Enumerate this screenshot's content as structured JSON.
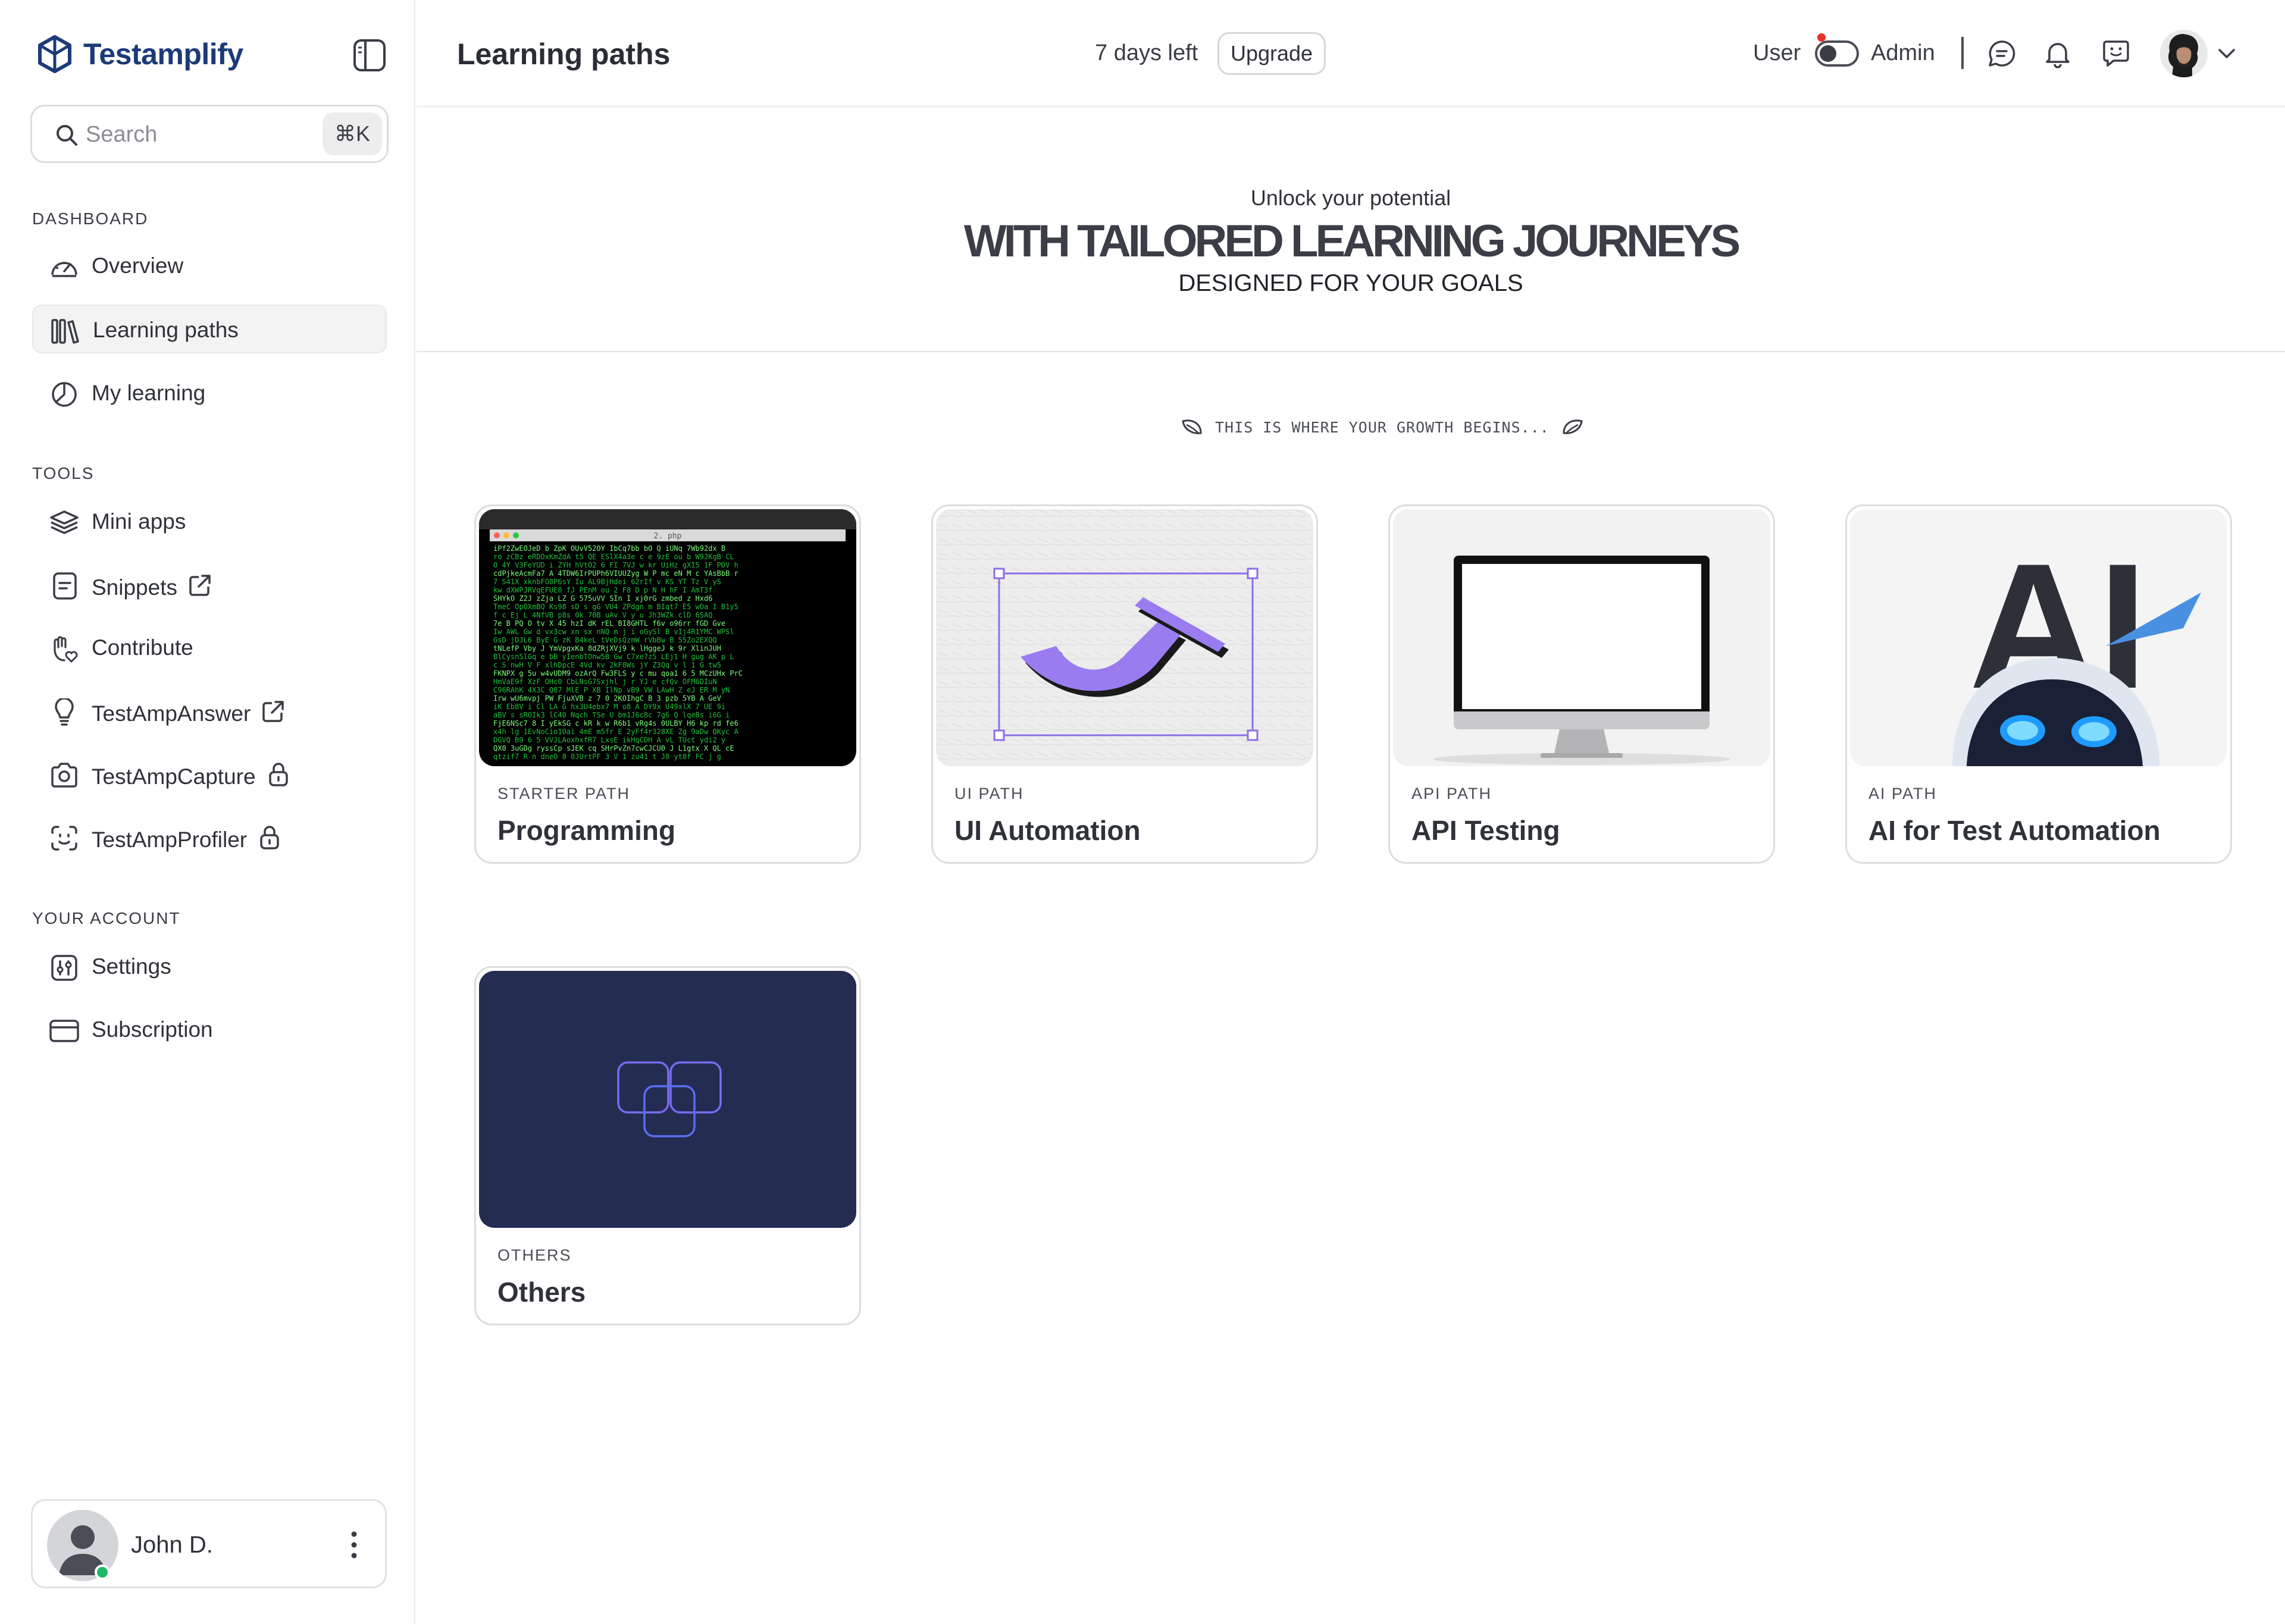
{
  "app": {
    "name": "Testamplify"
  },
  "search": {
    "placeholder": "Search",
    "shortcut": "⌘K"
  },
  "sidebar": {
    "sections": {
      "dashboard": "DASHBOARD",
      "tools": "TOOLS",
      "account": "YOUR ACCOUNT"
    },
    "items": [
      {
        "label": "Overview",
        "icon": "gauge-icon"
      },
      {
        "label": "Learning paths",
        "icon": "library-icon",
        "active": true
      },
      {
        "label": "My learning",
        "icon": "pie-chart-icon"
      },
      {
        "label": "Mini apps",
        "icon": "layers-icon"
      },
      {
        "label": "Snippets",
        "icon": "file-text-icon",
        "tail": "external-link-icon"
      },
      {
        "label": "Contribute",
        "icon": "hand-heart-icon"
      },
      {
        "label": "TestAmpAnswer",
        "icon": "lightbulb-icon",
        "tail": "external-link-icon"
      },
      {
        "label": "TestAmpCapture",
        "icon": "camera-icon",
        "tail": "lock-icon"
      },
      {
        "label": "TestAmpProfiler",
        "icon": "face-scan-icon",
        "tail": "lock-icon"
      },
      {
        "label": "Settings",
        "icon": "sliders-icon"
      },
      {
        "label": "Subscription",
        "icon": "credit-card-icon"
      }
    ]
  },
  "user": {
    "name": "John D.",
    "status": "online"
  },
  "header": {
    "title": "Learning paths",
    "trial": "7 days left",
    "upgrade": "Upgrade",
    "role_user": "User",
    "role_admin": "Admin",
    "admin_mode": false
  },
  "hero": {
    "kicker": "Unlock your potential",
    "headline": "WITH TAILORED LEARNING JOURNEYS",
    "sub": "DESIGNED FOR YOUR GOALS"
  },
  "tagline": "THIS IS WHERE YOUR GROWTH BEGINS...",
  "paths": [
    {
      "category": "STARTER PATH",
      "title": "Programming"
    },
    {
      "category": "UI PATH",
      "title": "UI Automation"
    },
    {
      "category": "API PATH",
      "title": "API Testing"
    },
    {
      "category": "AI PATH",
      "title": "AI for Test Automation"
    },
    {
      "category": "OTHERS",
      "title": "Others"
    }
  ],
  "thumbs": {
    "terminal_title": "2. php",
    "ai_letters": "AI"
  },
  "colors": {
    "brand": "#1d3a78",
    "notification": "#e5312b",
    "online": "#1fb866",
    "ui_accent": "#8b6fe6",
    "others_bg": "#252c52"
  }
}
